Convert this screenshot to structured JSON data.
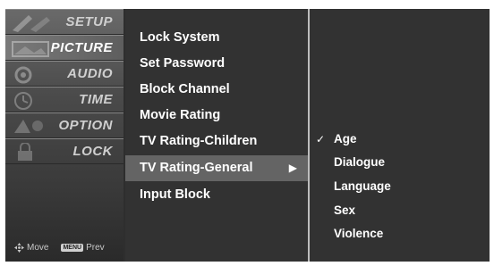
{
  "side_menu": {
    "tabs": [
      {
        "label": "SETUP",
        "active": false
      },
      {
        "label": "PICTURE",
        "active": true
      },
      {
        "label": "AUDIO",
        "active": false
      },
      {
        "label": "TIME",
        "active": false
      },
      {
        "label": "OPTION",
        "active": false
      },
      {
        "label": "LOCK",
        "active": false
      }
    ],
    "footer": {
      "move_label": "Move",
      "menu_key": "MENU",
      "prev_label": "Prev"
    }
  },
  "main_menu": {
    "items": [
      {
        "label": "Lock System"
      },
      {
        "label": "Set Password"
      },
      {
        "label": "Block Channel"
      },
      {
        "label": "Movie Rating"
      },
      {
        "label": "TV Rating-Children"
      },
      {
        "label": "TV Rating-General",
        "selected": true,
        "arrow": "▶"
      },
      {
        "label": "Input Block"
      }
    ]
  },
  "sub_menu": {
    "items": [
      {
        "label": "Age",
        "checked": true,
        "check": "✓"
      },
      {
        "label": "Dialogue",
        "checked": false
      },
      {
        "label": "Language",
        "checked": false
      },
      {
        "label": "Sex",
        "checked": false
      },
      {
        "label": "Violence",
        "checked": false
      }
    ]
  },
  "colors": {
    "background": "#2e2e2e",
    "selected": "#646464",
    "divider": "#bdbdbd",
    "text": "#ffffff"
  }
}
